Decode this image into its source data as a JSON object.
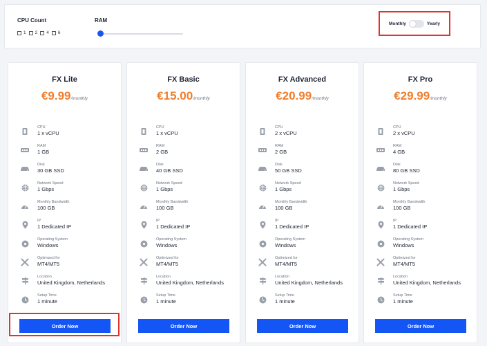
{
  "filters": {
    "cpu_label": "CPU Count",
    "cpu_options": [
      "1",
      "2",
      "4",
      "6"
    ],
    "ram_label": "RAM",
    "ram_value": 0,
    "billing_monthly": "Monthly",
    "billing_yearly": "Yearly",
    "billing_selected": "Monthly"
  },
  "colors": {
    "accent_blue": "#1456f5",
    "price_orange": "#f07d2a",
    "highlight_red": "#e0332b"
  },
  "plans": [
    {
      "name": "FX Lite",
      "price": "€9.99",
      "period": "/monthly",
      "specs": [
        {
          "label": "CPU",
          "value": "1 x vCPU",
          "icon": "cpu-icon"
        },
        {
          "label": "RAM",
          "value": "1 GB",
          "icon": "ram-icon"
        },
        {
          "label": "Disk",
          "value": "30 GB SSD",
          "icon": "disk-icon"
        },
        {
          "label": "Network Speed",
          "value": "1 Gbps",
          "icon": "globe-icon"
        },
        {
          "label": "Monthly Bandwidth",
          "value": "100 GB",
          "icon": "gauge-icon"
        },
        {
          "label": "IP",
          "value": "1 Dedicated IP",
          "icon": "location-pin-icon"
        },
        {
          "label": "Operating System",
          "value": "Windows",
          "icon": "disc-icon"
        },
        {
          "label": "Optimized for",
          "value": "MT4/MT5",
          "icon": "tools-icon"
        },
        {
          "label": "Location",
          "value": "United Kingdom, Netherlands",
          "icon": "signpost-icon"
        },
        {
          "label": "Setup Time",
          "value": "1 minute",
          "icon": "clock-icon"
        }
      ],
      "button": "Order Now"
    },
    {
      "name": "FX Basic",
      "price": "€15.00",
      "period": "/monthly",
      "specs": [
        {
          "label": "CPU",
          "value": "1 x vCPU",
          "icon": "cpu-icon"
        },
        {
          "label": "RAM",
          "value": "2 GB",
          "icon": "ram-icon"
        },
        {
          "label": "Disk",
          "value": "40 GB SSD",
          "icon": "disk-icon"
        },
        {
          "label": "Network Speed",
          "value": "1 Gbps",
          "icon": "globe-icon"
        },
        {
          "label": "Monthly Bandwidth",
          "value": "100 GB",
          "icon": "gauge-icon"
        },
        {
          "label": "IP",
          "value": "1 Dedicated IP",
          "icon": "location-pin-icon"
        },
        {
          "label": "Operating System",
          "value": "Windows",
          "icon": "disc-icon"
        },
        {
          "label": "Optimized for",
          "value": "MT4/MT5",
          "icon": "tools-icon"
        },
        {
          "label": "Location",
          "value": "United Kingdom, Netherlands",
          "icon": "signpost-icon"
        },
        {
          "label": "Setup Time",
          "value": "1 minute",
          "icon": "clock-icon"
        }
      ],
      "button": "Order Now"
    },
    {
      "name": "FX Advanced",
      "price": "€20.99",
      "period": "/monthly",
      "specs": [
        {
          "label": "CPU",
          "value": "2 x vCPU",
          "icon": "cpu-icon"
        },
        {
          "label": "RAM",
          "value": "2 GB",
          "icon": "ram-icon"
        },
        {
          "label": "Disk",
          "value": "50 GB SSD",
          "icon": "disk-icon"
        },
        {
          "label": "Network Speed",
          "value": "1 Gbps",
          "icon": "globe-icon"
        },
        {
          "label": "Monthly Bandwidth",
          "value": "100 GB",
          "icon": "gauge-icon"
        },
        {
          "label": "IP",
          "value": "1 Dedicated IP",
          "icon": "location-pin-icon"
        },
        {
          "label": "Operating System",
          "value": "Windows",
          "icon": "disc-icon"
        },
        {
          "label": "Optimized for",
          "value": "MT4/MT5",
          "icon": "tools-icon"
        },
        {
          "label": "Location",
          "value": "United Kingdom, Netherlands",
          "icon": "signpost-icon"
        },
        {
          "label": "Setup Time",
          "value": "1 minute",
          "icon": "clock-icon"
        }
      ],
      "button": "Order Now"
    },
    {
      "name": "FX Pro",
      "price": "€29.99",
      "period": "/monthly",
      "specs": [
        {
          "label": "CPU",
          "value": "2 x vCPU",
          "icon": "cpu-icon"
        },
        {
          "label": "RAM",
          "value": "4 GB",
          "icon": "ram-icon"
        },
        {
          "label": "Disk",
          "value": "80 GB SSD",
          "icon": "disk-icon"
        },
        {
          "label": "Network Speed",
          "value": "1 Gbps",
          "icon": "globe-icon"
        },
        {
          "label": "Monthly Bandwidth",
          "value": "100 GB",
          "icon": "gauge-icon"
        },
        {
          "label": "IP",
          "value": "1 Dedicated IP",
          "icon": "location-pin-icon"
        },
        {
          "label": "Operating System",
          "value": "Windows",
          "icon": "disc-icon"
        },
        {
          "label": "Optimized for",
          "value": "MT4/MT5",
          "icon": "tools-icon"
        },
        {
          "label": "Location",
          "value": "United Kingdom, Netherlands",
          "icon": "signpost-icon"
        },
        {
          "label": "Setup Time",
          "value": "1 minute",
          "icon": "clock-icon"
        }
      ],
      "button": "Order Now"
    }
  ]
}
